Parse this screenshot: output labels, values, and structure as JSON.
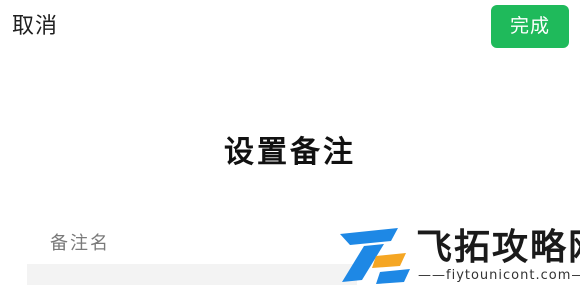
{
  "header": {
    "cancel_label": "取消",
    "done_label": "完成"
  },
  "main": {
    "title": "设置备注",
    "remark_label": "备注名"
  },
  "watermark": {
    "name": "飞拓攻略网",
    "url": "——fiytounicont.com——"
  },
  "colors": {
    "accent": "#1fba5b",
    "logo_blue": "#1e88e5",
    "logo_orange": "#f5a623"
  }
}
